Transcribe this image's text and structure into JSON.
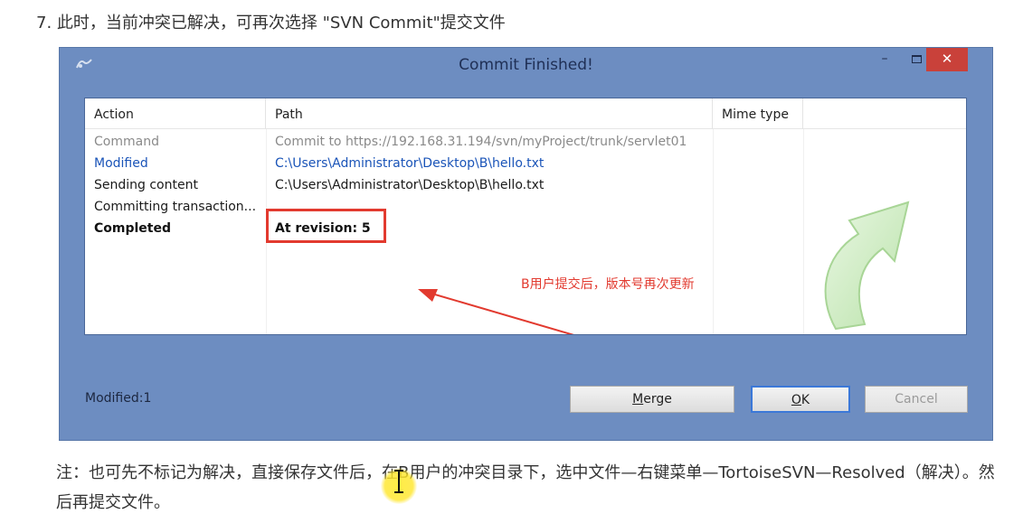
{
  "step_text": "7. 此时，当前冲突已解决，可再次选择 \"SVN Commit\"提交文件",
  "window": {
    "title": "Commit Finished!",
    "controls": {
      "minimize": "–",
      "close": "✕"
    }
  },
  "table": {
    "headers": {
      "action": "Action",
      "path": "Path",
      "mime": "Mime type"
    },
    "rows": [
      {
        "action": "Command",
        "path": "Commit to https://192.168.31.194/svn/myProject/trunk/servlet01",
        "style": "gray"
      },
      {
        "action": "Modified",
        "path": "C:\\Users\\Administrator\\Desktop\\B\\hello.txt",
        "style": "blue"
      },
      {
        "action": "Sending content",
        "path": "C:\\Users\\Administrator\\Desktop\\B\\hello.txt",
        "style": "black"
      },
      {
        "action": "Committing transaction...",
        "path": "",
        "style": "black"
      },
      {
        "action": "Completed",
        "path": "At revision: 5",
        "style": "bold"
      }
    ]
  },
  "annotation": {
    "text": "B用户提交后，版本号再次更新",
    "color": "#e23a2f"
  },
  "status": {
    "text": "Modified:1"
  },
  "buttons": {
    "merge": {
      "accel": "M",
      "rest": "erge"
    },
    "ok": {
      "accel": "O",
      "rest": "K"
    },
    "cancel": "Cancel"
  },
  "note_text": "注：也可先不标记为解决，直接保存文件后，在B用户的冲突目录下，选中文件—右键菜单—TortoiseSVN—Resolved（解决）。然后再提交文件。",
  "colors": {
    "window_bg": "#6d8dc1",
    "close_button": "#c9413a",
    "highlight_red": "#e23a2f",
    "link_blue": "#1a54b8",
    "cursor_highlight": "#ffe83c"
  },
  "icons": {
    "app": "tortoisesvn-icon",
    "decor": "green-curved-arrow-icon",
    "cursor": "text-cursor-icon"
  }
}
